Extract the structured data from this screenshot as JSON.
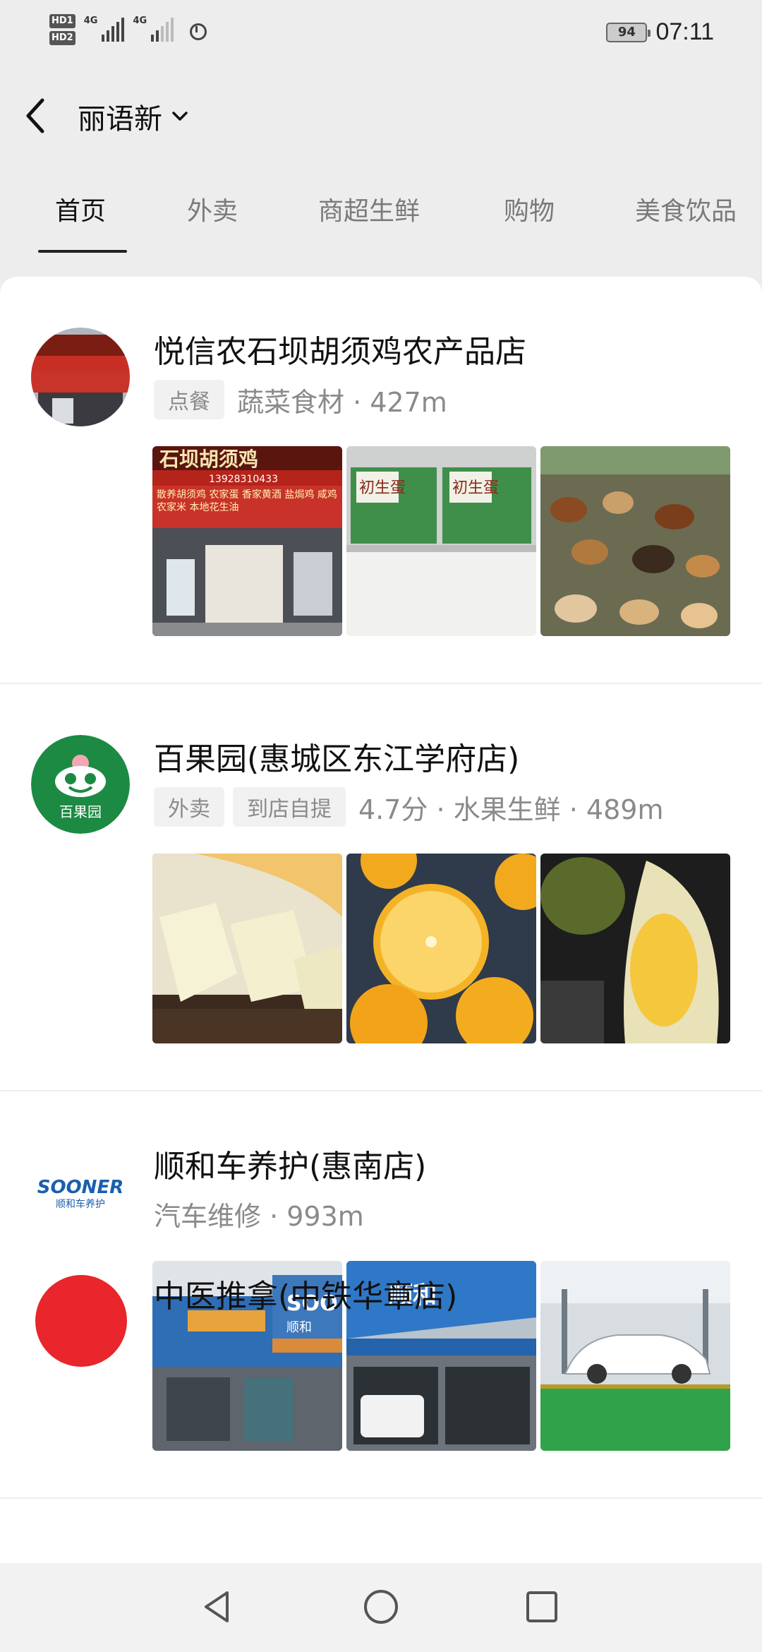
{
  "status_bar": {
    "sim1": "HD1",
    "sim2": "HD2",
    "net1": "4G",
    "net2": "4G",
    "battery": "94",
    "time": "07:11"
  },
  "header": {
    "title": "丽语新"
  },
  "tabs": [
    {
      "label": "首页",
      "active": true
    },
    {
      "label": "外卖"
    },
    {
      "label": "商超生鲜"
    },
    {
      "label": "购物"
    },
    {
      "label": "美食饮品"
    }
  ],
  "stores": [
    {
      "name": "悦信农石坝胡须鸡农产品店",
      "tags": [
        "点餐"
      ],
      "meta": "蔬菜食材 · 427m",
      "avatar_icon": "storefront-photo",
      "thumbs": [
        {
          "icon": "storefront-photo",
          "sign_text": "石坝胡须鸡",
          "phone": "13928310433",
          "banner": "散养胡须鸡 农家蛋 香家黄酒 盐焗鸡 咸鸡 农家米 本地花生油"
        },
        {
          "icon": "egg-boxes-photo",
          "label": "初生蛋"
        },
        {
          "icon": "chickens-photo"
        }
      ]
    },
    {
      "name": "百果园(惠城区东江学府店)",
      "tags": [
        "外卖",
        "到店自提"
      ],
      "meta": "4.7分 · 水果生鲜 · 489m",
      "avatar_icon": "fruit-mascot-logo",
      "avatar_text": "百果园",
      "thumbs": [
        {
          "icon": "melon-photo"
        },
        {
          "icon": "orange-photo"
        },
        {
          "icon": "durian-photo"
        }
      ]
    },
    {
      "name": "顺和车养护(惠南店)",
      "tags": [],
      "meta": "汽车维修 · 993m",
      "avatar_icon": "sooner-logo",
      "avatar_brand": "SOONER",
      "avatar_sub": "顺和车养护",
      "thumbs": [
        {
          "icon": "building-photo",
          "sign_text": "SOO",
          "sign_sub": "顺和"
        },
        {
          "icon": "garage-photo",
          "sign_text": "顺和"
        },
        {
          "icon": "car-wash-photo"
        }
      ]
    }
  ],
  "partial_store": {
    "name": "中医推拿(中铁华章店)"
  },
  "colors": {
    "background": "#ededed",
    "card": "#ffffff",
    "tag_bg": "#f1f1f1",
    "meta_text": "#8a8a8a",
    "fruit_green": "#1c8a43",
    "sooner_blue": "#1a5fae"
  }
}
